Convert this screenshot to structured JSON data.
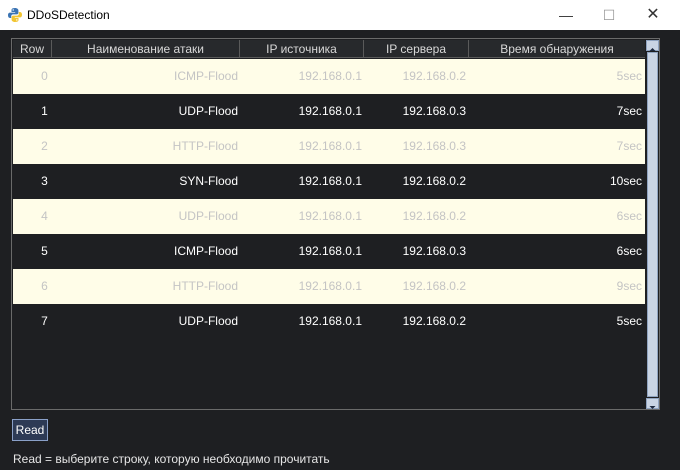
{
  "window": {
    "title": "DDoSDetection",
    "controls": {
      "minimize": "—",
      "maximize": "☐",
      "close": "✕"
    }
  },
  "table": {
    "columns": [
      "Row",
      "Наименование атаки",
      "IP источника",
      "IP сервера",
      "Время обнаружения"
    ],
    "rows": [
      {
        "row": "0",
        "attack": "ICMP-Flood",
        "src_ip": "192.168.0.1",
        "srv_ip": "192.168.0.2",
        "time": "5sec"
      },
      {
        "row": "1",
        "attack": "UDP-Flood",
        "src_ip": "192.168.0.1",
        "srv_ip": "192.168.0.3",
        "time": "7sec"
      },
      {
        "row": "2",
        "attack": "HTTP-Flood",
        "src_ip": "192.168.0.1",
        "srv_ip": "192.168.0.3",
        "time": "7sec"
      },
      {
        "row": "3",
        "attack": "SYN-Flood",
        "src_ip": "192.168.0.1",
        "srv_ip": "192.168.0.2",
        "time": "10sec"
      },
      {
        "row": "4",
        "attack": "UDP-Flood",
        "src_ip": "192.168.0.1",
        "srv_ip": "192.168.0.2",
        "time": "6sec"
      },
      {
        "row": "5",
        "attack": "ICMP-Flood",
        "src_ip": "192.168.0.1",
        "srv_ip": "192.168.0.3",
        "time": "6sec"
      },
      {
        "row": "6",
        "attack": "HTTP-Flood",
        "src_ip": "192.168.0.1",
        "srv_ip": "192.168.0.2",
        "time": "9sec"
      },
      {
        "row": "7",
        "attack": "UDP-Flood",
        "src_ip": "192.168.0.1",
        "srv_ip": "192.168.0.2",
        "time": "5sec"
      }
    ]
  },
  "read_button": {
    "label": "Read"
  },
  "hint": "Read = выберите строку, которую необходимо прочитать",
  "icons": {
    "app": "python-logo-icon",
    "scroll_up": "arrow-up-icon",
    "scroll_down": "arrow-down-icon"
  },
  "colors": {
    "background": "#1e1f22",
    "light_row": "#fffde8",
    "button": "#2d3a55"
  }
}
